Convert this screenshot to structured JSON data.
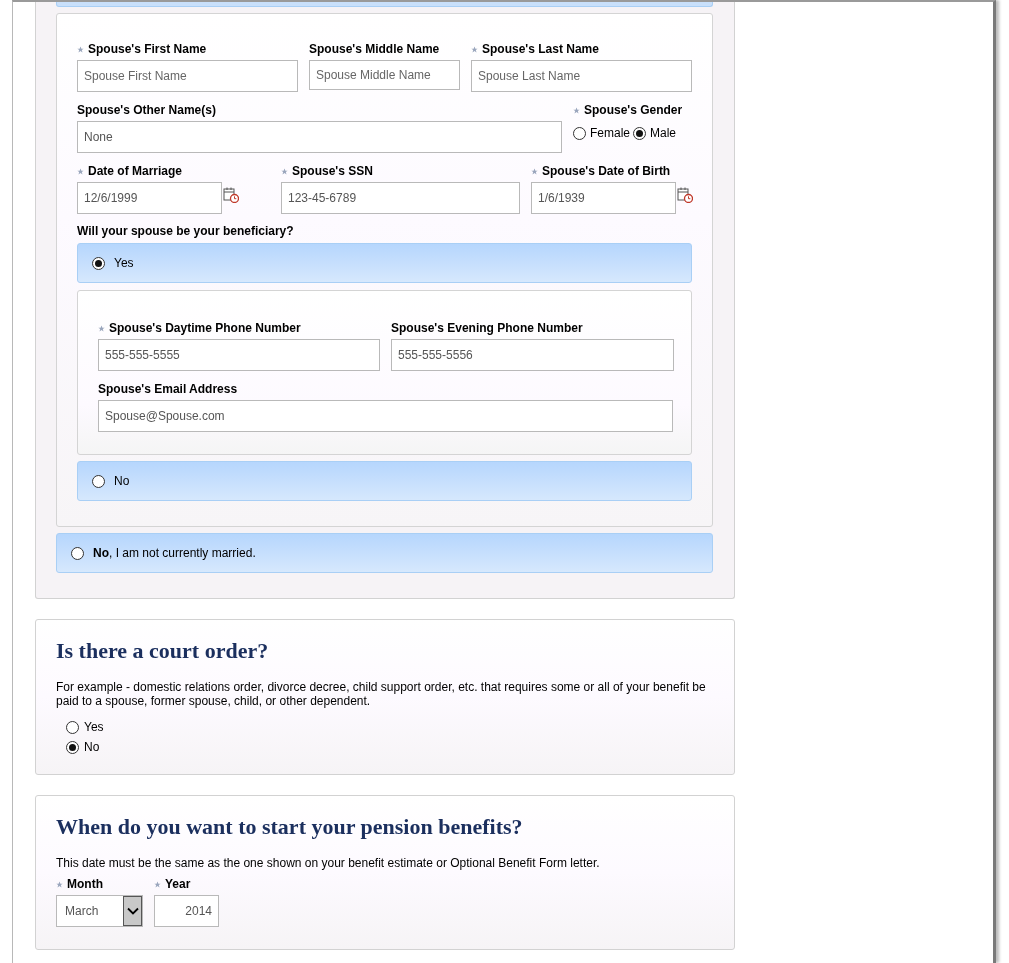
{
  "spouse_details": {
    "rows": [
      [
        {
          "kind": "text",
          "label": "Spouse's First Name",
          "required": true,
          "placeholder": "Spouse First Name"
        },
        {
          "kind": "text",
          "label": "Spouse's Middle Name",
          "required": false,
          "placeholder": "Spouse Middle Name"
        },
        {
          "kind": "text",
          "label": "Spouse's Last Name",
          "required": true,
          "placeholder": "Spouse Last Name"
        }
      ],
      [
        {
          "kind": "text",
          "label": "Spouse's Other Name(s)",
          "required": false,
          "value": "None"
        },
        {
          "kind": "radio",
          "label": "Spouse's Gender",
          "required": true,
          "options": [
            {
              "label": "Female",
              "selected": false
            },
            {
              "label": "Male",
              "selected": true
            }
          ]
        }
      ],
      [
        {
          "kind": "date",
          "label": "Date of Marriage",
          "required": true,
          "value": "12/6/1999"
        },
        {
          "kind": "text",
          "label": "Spouse's SSN",
          "required": true,
          "value": "123-45-6789"
        },
        {
          "kind": "date",
          "label": "Spouse's Date of Birth",
          "required": true,
          "value": "1/6/1939"
        }
      ]
    ],
    "beneficiary": {
      "question": "Will your spouse be your beneficiary?",
      "options": [
        {
          "label": "Yes",
          "selected": true,
          "details": [
            [
              {
                "kind": "text",
                "label": "Spouse's Daytime Phone Number",
                "required": true,
                "value": "555-555-5555"
              },
              {
                "kind": "text",
                "label": "Spouse's Evening Phone Number",
                "required": false,
                "value": "555-555-5556"
              }
            ],
            [
              {
                "kind": "text",
                "label": "Spouse's Email Address",
                "required": false,
                "value": "Spouse@Spouse.com"
              }
            ]
          ]
        },
        {
          "label": "No",
          "selected": false
        }
      ]
    }
  },
  "not_married": {
    "label": "**No**, I am not currently married.",
    "selected": false
  },
  "court_order": {
    "title": "Is there a court order?",
    "description": "For example - domestic relations order, divorce decree, child support order, etc. that requires some or all of your benefit be paid to a spouse, former spouse, child, or other dependent.",
    "options": [
      {
        "label": "Yes",
        "selected": false
      },
      {
        "label": "No",
        "selected": true
      }
    ]
  },
  "pension_start": {
    "title": "When do you want to start your pension benefits?",
    "description": "This date must be the same as the one shown on your benefit estimate or Optional Benefit Form letter.",
    "month": {
      "label": "Month",
      "required": true,
      "value": "March"
    },
    "year": {
      "label": "Year",
      "required": true,
      "value": "2014"
    }
  }
}
